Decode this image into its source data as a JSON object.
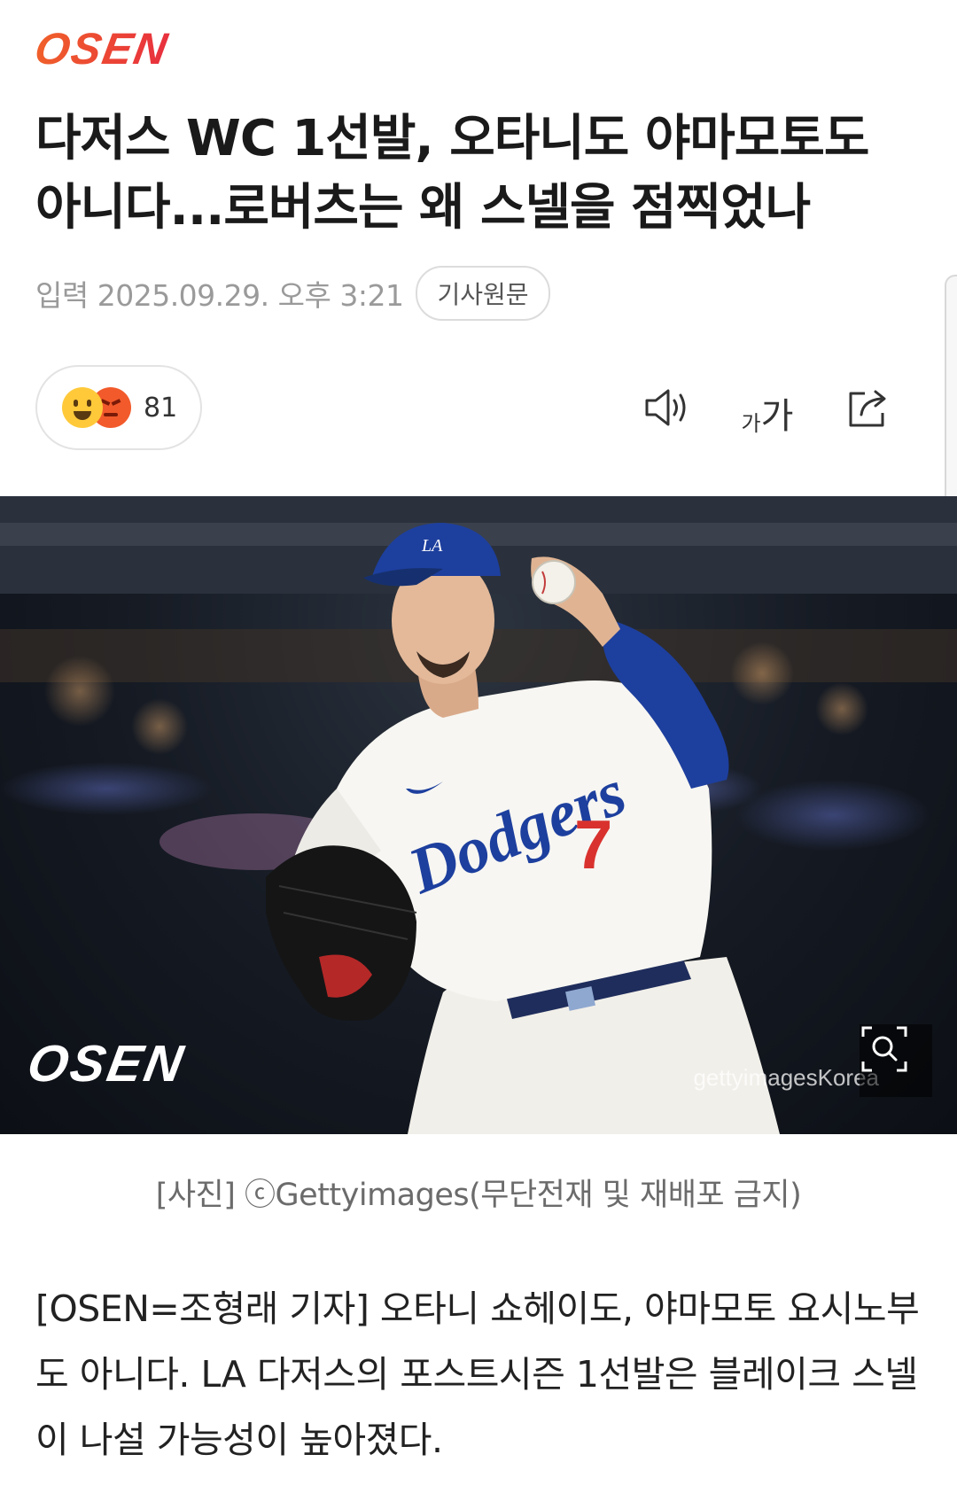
{
  "header": {
    "logo": "OSEN"
  },
  "article": {
    "headline": "다저스 WC 1선발, 오타니도 야마모토도 아니다...로버츠는 왜 스넬을 점찍었나",
    "date": "입력 2025.09.29. 오후 3:21",
    "original_button": "기사원문",
    "reaction_count": "81",
    "toolbar": {
      "tts_icon": "speaker-icon",
      "font_small": "가",
      "font_big": "가",
      "share_icon": "share-icon"
    },
    "photo": {
      "overlay_logo": "OSEN",
      "watermark": "gettyimagesKorea",
      "zoom_icon": "zoom-icon",
      "jersey_team": "Dodgers",
      "jersey_number": "7"
    },
    "caption": "[사진] ⓒGettyimages(무단전재 및 재배포 금지)",
    "body": "[OSEN=조형래 기자] 오타니 쇼헤이도, 야마모토 요시노부도 아니다. LA 다저스의 포스트시즌 1선발은 블레이크 스넬이 나설 가능성이 높아졌다."
  },
  "colors": {
    "brand": "#e8303e",
    "dodger_blue": "#1d3f9e"
  }
}
